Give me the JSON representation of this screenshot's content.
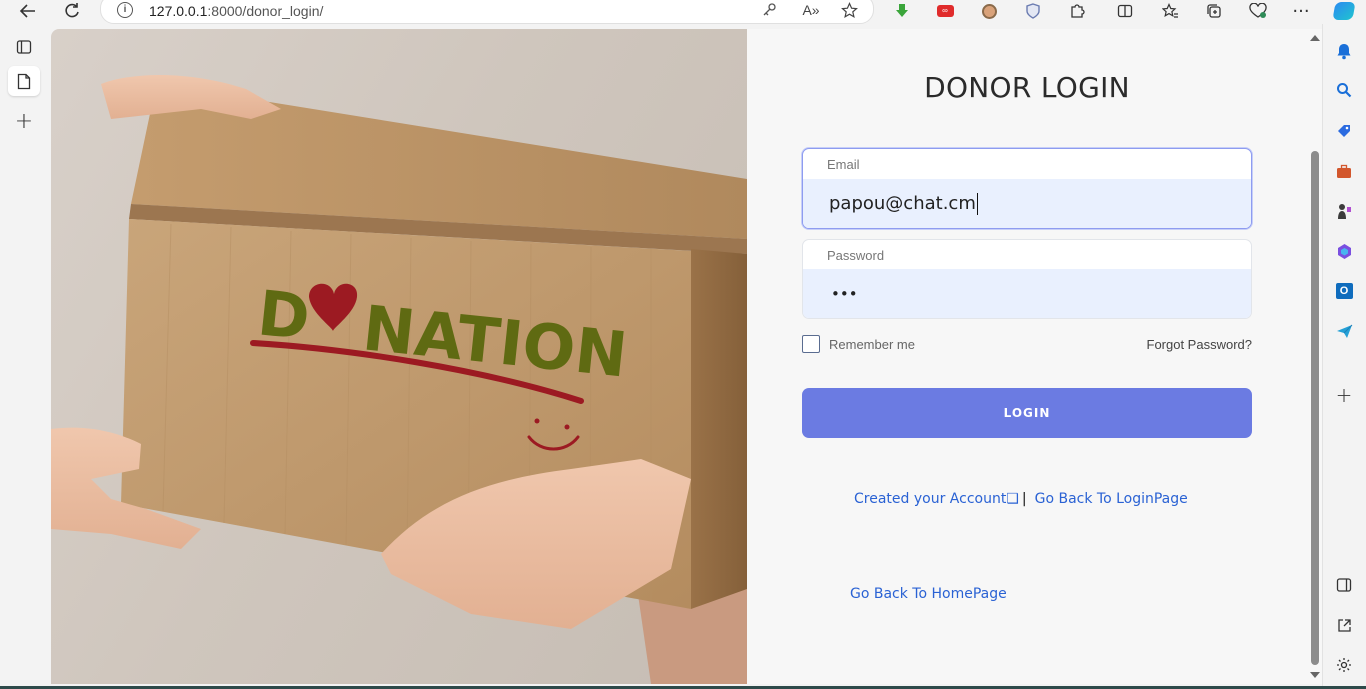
{
  "browser": {
    "url_host": "127.0.0.1",
    "url_path": ":8000/donor_login/"
  },
  "photo": {
    "box_text_prefix": "D",
    "box_text_suffix": "NATION"
  },
  "login": {
    "title": "DONOR LOGIN",
    "email_label": "Email",
    "email_value": "papou@chat.cm",
    "password_label": "Password",
    "password_value": "•••",
    "remember_label": "Remember me",
    "forgot_label": "Forgot Password?",
    "login_button": "LOGIN",
    "create_account_link": "Created your Account❑",
    "separator": "|",
    "back_login_link": "Go Back To LoginPage",
    "back_home_link": "Go Back To HomePage"
  },
  "colors": {
    "login_button": "#6b7be2",
    "link": "#2a62d4",
    "field_fill": "#e9f0fe",
    "donation_green": "#5f6a12",
    "donation_red": "#9c1a22"
  }
}
